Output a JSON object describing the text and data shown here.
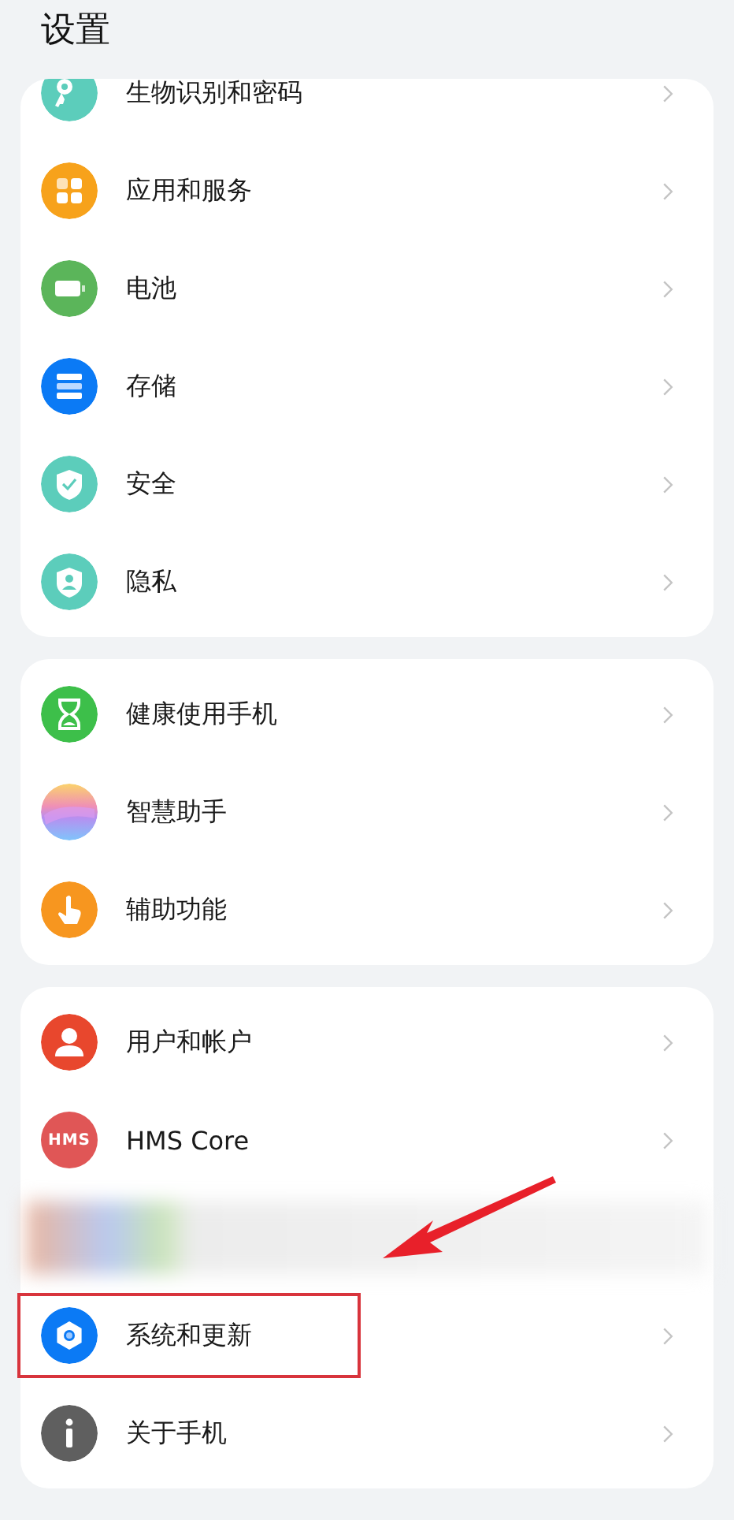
{
  "header": {
    "title": "设置"
  },
  "cards": [
    {
      "cut_top": true,
      "items": [
        {
          "kind": "link",
          "label": "生物识别和密码",
          "color": "#5ccdbb"
        },
        {
          "kind": "link",
          "label": "应用和服务",
          "color": "#f7a21b"
        },
        {
          "kind": "link",
          "label": "电池",
          "color": "#5bb55a"
        },
        {
          "kind": "link",
          "label": "存储",
          "color": "#0b7af5"
        },
        {
          "kind": "link",
          "label": "安全",
          "color": "#5ccdbb"
        },
        {
          "kind": "link",
          "label": "隐私",
          "color": "#5ccdbb"
        }
      ]
    },
    {
      "cut_top": false,
      "items": [
        {
          "kind": "link",
          "label": "健康使用手机",
          "color": "#3dbf4a"
        },
        {
          "kind": "link",
          "label": "智慧助手"
        },
        {
          "kind": "link",
          "label": "辅助功能",
          "color": "#f7961f"
        }
      ]
    },
    {
      "cut_top": false,
      "items": [
        {
          "kind": "link",
          "label": "用户和帐户",
          "color": "#e8472d"
        },
        {
          "kind": "link",
          "label": "HMS Core",
          "color": "#e05656",
          "icon_text": "HMS"
        },
        {
          "kind": "blurred"
        },
        {
          "kind": "link",
          "label": "系统和更新",
          "color": "#0b7af5",
          "highlighted": true,
          "pointer_arrow": true
        },
        {
          "kind": "link",
          "label": "关于手机",
          "color": "#5f5f5f"
        }
      ]
    }
  ]
}
